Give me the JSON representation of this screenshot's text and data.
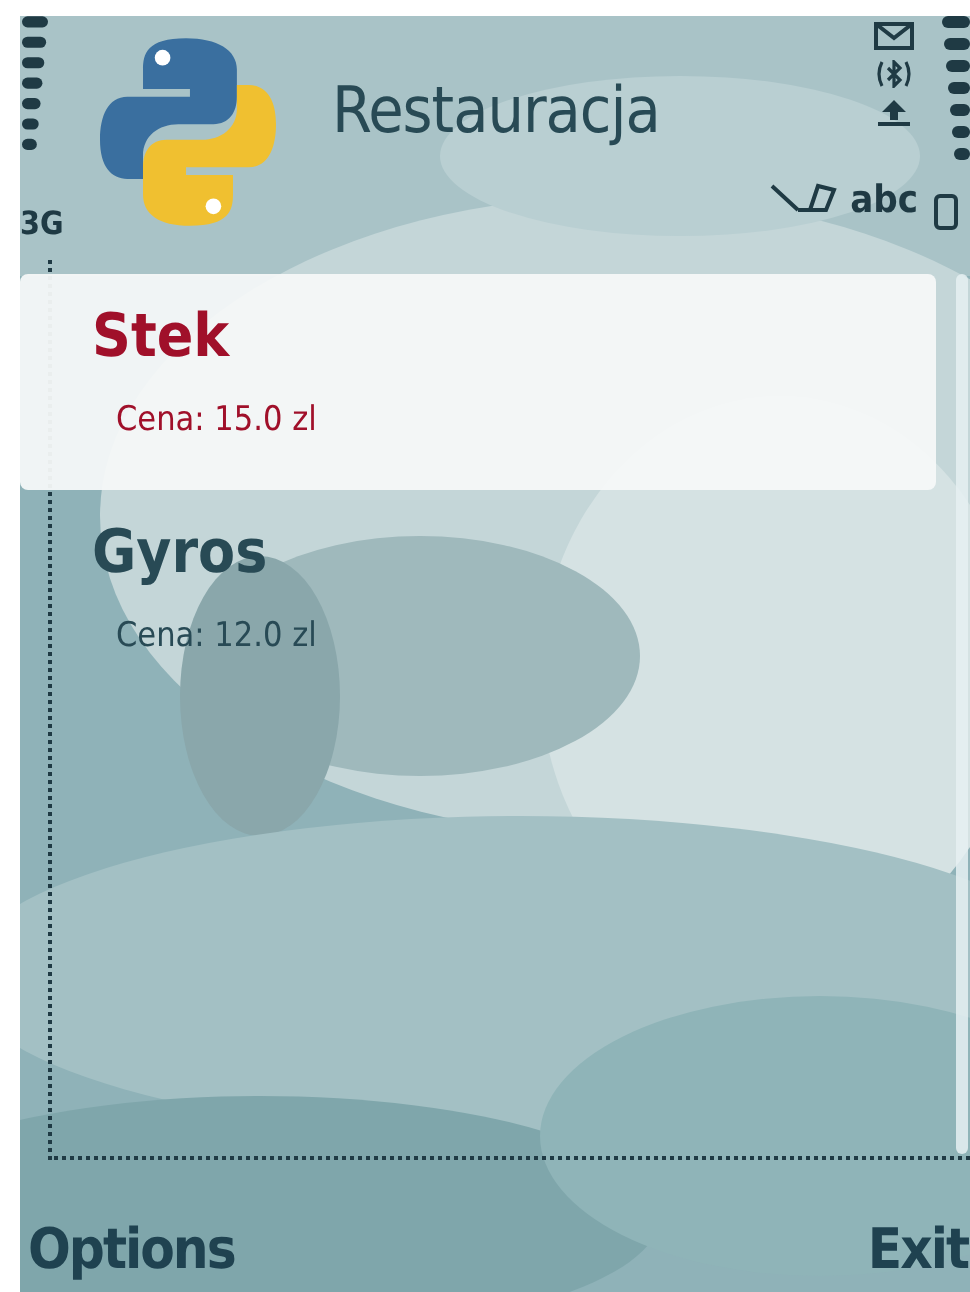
{
  "status_bar": {
    "network": "3G",
    "input_mode": "abc"
  },
  "title": "Restauracja",
  "items": [
    {
      "name": "Stek",
      "price": "Cena: 15.0 zl",
      "selected": true
    },
    {
      "name": "Gyros",
      "price": "Cena: 12.0 zl",
      "selected": false
    }
  ],
  "softkeys": {
    "left": "Options",
    "right": "Exit"
  }
}
